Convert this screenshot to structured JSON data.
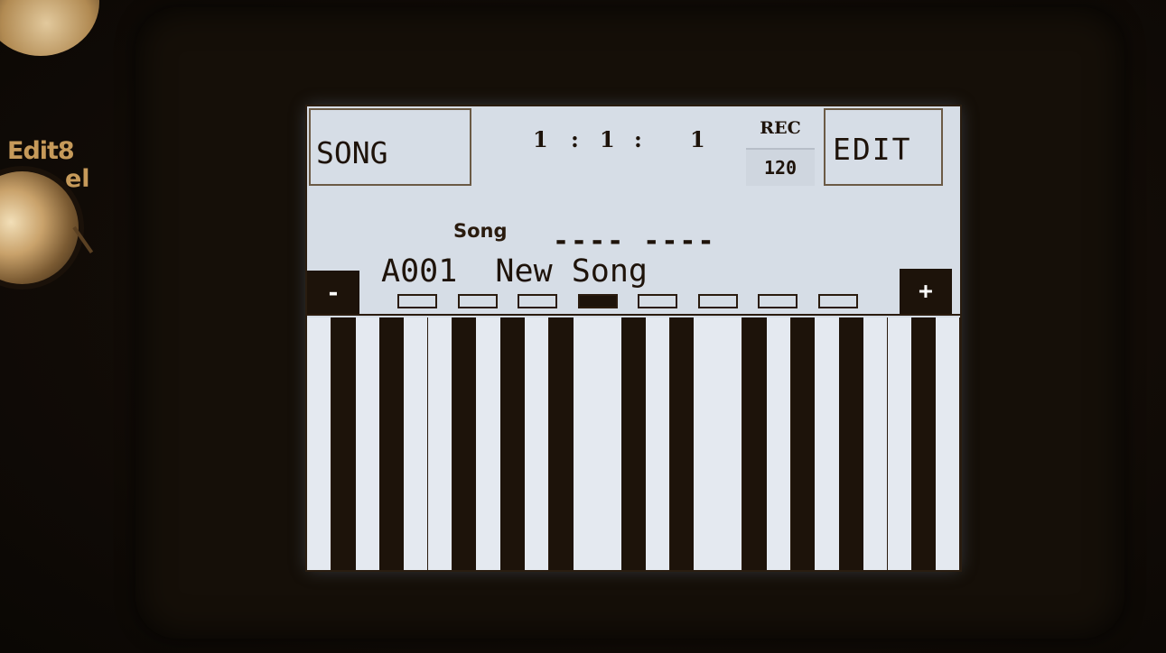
{
  "hardware": {
    "side_label_line1": "Edit8",
    "side_label_line2": "el"
  },
  "screen": {
    "song_button_label": "SONG",
    "edit_button_label": "EDIT",
    "rec_label": "REC",
    "bpm": "120",
    "position": {
      "bar": "1",
      "sep1": ":",
      "beat": "1",
      "sep2": ":",
      "tick": "1"
    },
    "song_label": "Song",
    "dashes": "---- ----",
    "song_name": "A001  New Song",
    "minus_label": "-",
    "plus_label": "+",
    "page_count": 8,
    "active_page": 4,
    "keyboard_pattern": [
      "white",
      "black",
      "white",
      "black",
      "white",
      "white",
      "black",
      "white",
      "black",
      "white",
      "black",
      "white",
      "white",
      "black",
      "white",
      "black",
      "white",
      "white",
      "black",
      "white",
      "black",
      "white",
      "black",
      "white",
      "white",
      "black",
      "white"
    ]
  },
  "colors": {
    "lcd_background": "#d6dde6",
    "lcd_ink": "#1d130a",
    "panel_accent": "#c69a5a"
  }
}
